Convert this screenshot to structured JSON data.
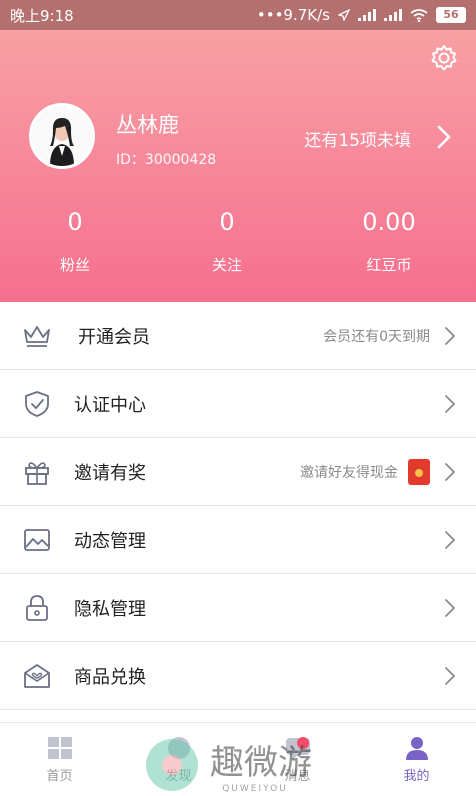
{
  "status_bar": {
    "time": "晚上9:18",
    "speed": "•••9.7K/s",
    "battery": "56"
  },
  "profile": {
    "name": "丛林鹿",
    "id_text": "ID：30000428",
    "incomplete": "还有15项未填"
  },
  "stats": [
    {
      "value": "0",
      "label": "粉丝"
    },
    {
      "value": "0",
      "label": "关注"
    },
    {
      "value": "0.00",
      "label": "红豆币"
    }
  ],
  "menu": [
    {
      "label": "开通会员",
      "hint": "会员还有0天到期",
      "icon": "crown-icon"
    },
    {
      "label": "认证中心",
      "hint": "",
      "icon": "shield-check-icon"
    },
    {
      "label": "邀请有奖",
      "hint": "邀请好友得现金",
      "icon": "gift-icon"
    },
    {
      "label": "动态管理",
      "hint": "",
      "icon": "image-icon"
    },
    {
      "label": "隐私管理",
      "hint": "",
      "icon": "lock-icon"
    },
    {
      "label": "商品兑换",
      "hint": "",
      "icon": "envelope-heart-icon"
    }
  ],
  "tabs": [
    {
      "label": "首页",
      "icon": "grid-icon"
    },
    {
      "label": "发现",
      "icon": "discover-icon"
    },
    {
      "label": "消息",
      "icon": "message-icon"
    },
    {
      "label": "我的",
      "icon": "person-icon"
    }
  ],
  "watermark": {
    "text": "趣微游",
    "sub": "QUWEIYOU"
  },
  "colors": {
    "header_top": "#f8a6a6",
    "header_bottom": "#f56f8f",
    "active_tab": "#7a63c7",
    "icon_stroke": "#6b6f86"
  }
}
